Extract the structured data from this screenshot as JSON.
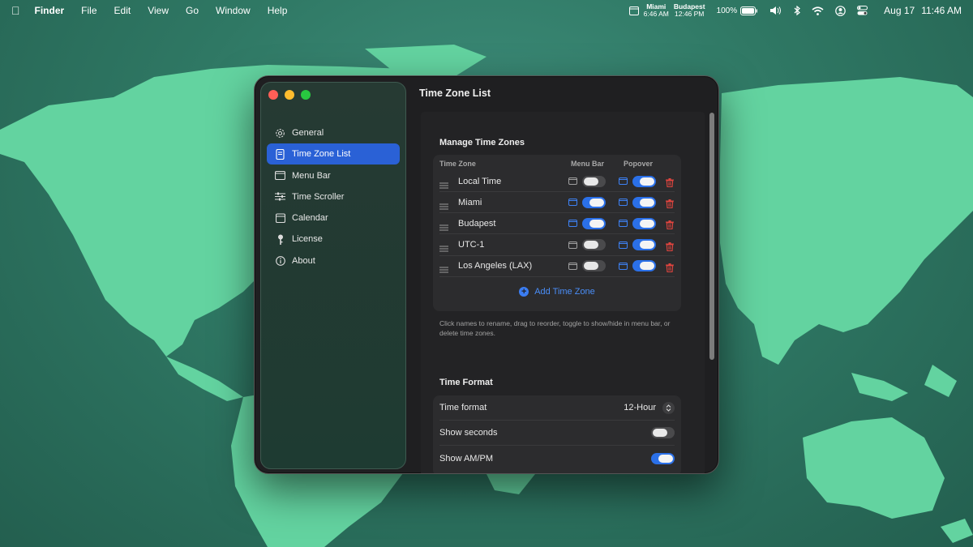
{
  "menubar": {
    "app_name": "Finder",
    "menus": [
      "File",
      "Edit",
      "View",
      "Go",
      "Window",
      "Help"
    ],
    "clocks": [
      {
        "city": "Miami",
        "time": "6:46 AM"
      },
      {
        "city": "Budapest",
        "time": "12:46 PM"
      }
    ],
    "battery": "100%",
    "date": "Aug 17",
    "time": "11:46 AM"
  },
  "window": {
    "title": "Time Zone List",
    "sidebar": [
      {
        "label": "General",
        "icon": "gear-icon"
      },
      {
        "label": "Time Zone List",
        "icon": "list-icon",
        "active": true
      },
      {
        "label": "Menu Bar",
        "icon": "menubar-icon"
      },
      {
        "label": "Time Scroller",
        "icon": "sliders-icon"
      },
      {
        "label": "Calendar",
        "icon": "calendar-icon"
      },
      {
        "label": "License",
        "icon": "key-icon"
      },
      {
        "label": "About",
        "icon": "info-icon"
      }
    ],
    "manage": {
      "title": "Manage Time Zones",
      "col_timezone": "Time Zone",
      "col_menubar": "Menu Bar",
      "col_popover": "Popover",
      "rows": [
        {
          "name": "Local Time",
          "menubar": false,
          "popover": true
        },
        {
          "name": "Miami",
          "menubar": true,
          "popover": true
        },
        {
          "name": "Budapest",
          "menubar": true,
          "popover": true
        },
        {
          "name": "UTC-1",
          "menubar": false,
          "popover": true
        },
        {
          "name": "Los Angeles (LAX)",
          "menubar": false,
          "popover": true
        }
      ],
      "add_label": "Add Time Zone",
      "help": "Click names to rename, drag to reorder, toggle to show/hide in menu bar, or delete time zones."
    },
    "format": {
      "title": "Time Format",
      "time_format_label": "Time format",
      "time_format_value": "12-Hour",
      "show_seconds_label": "Show seconds",
      "show_seconds": false,
      "show_ampm_label": "Show AM/PM",
      "show_ampm": true
    }
  },
  "colors": {
    "accent": "#2a61d6",
    "toggle_on": "#2b70e8",
    "delete": "#e0443e",
    "land": "#63d3a0"
  }
}
